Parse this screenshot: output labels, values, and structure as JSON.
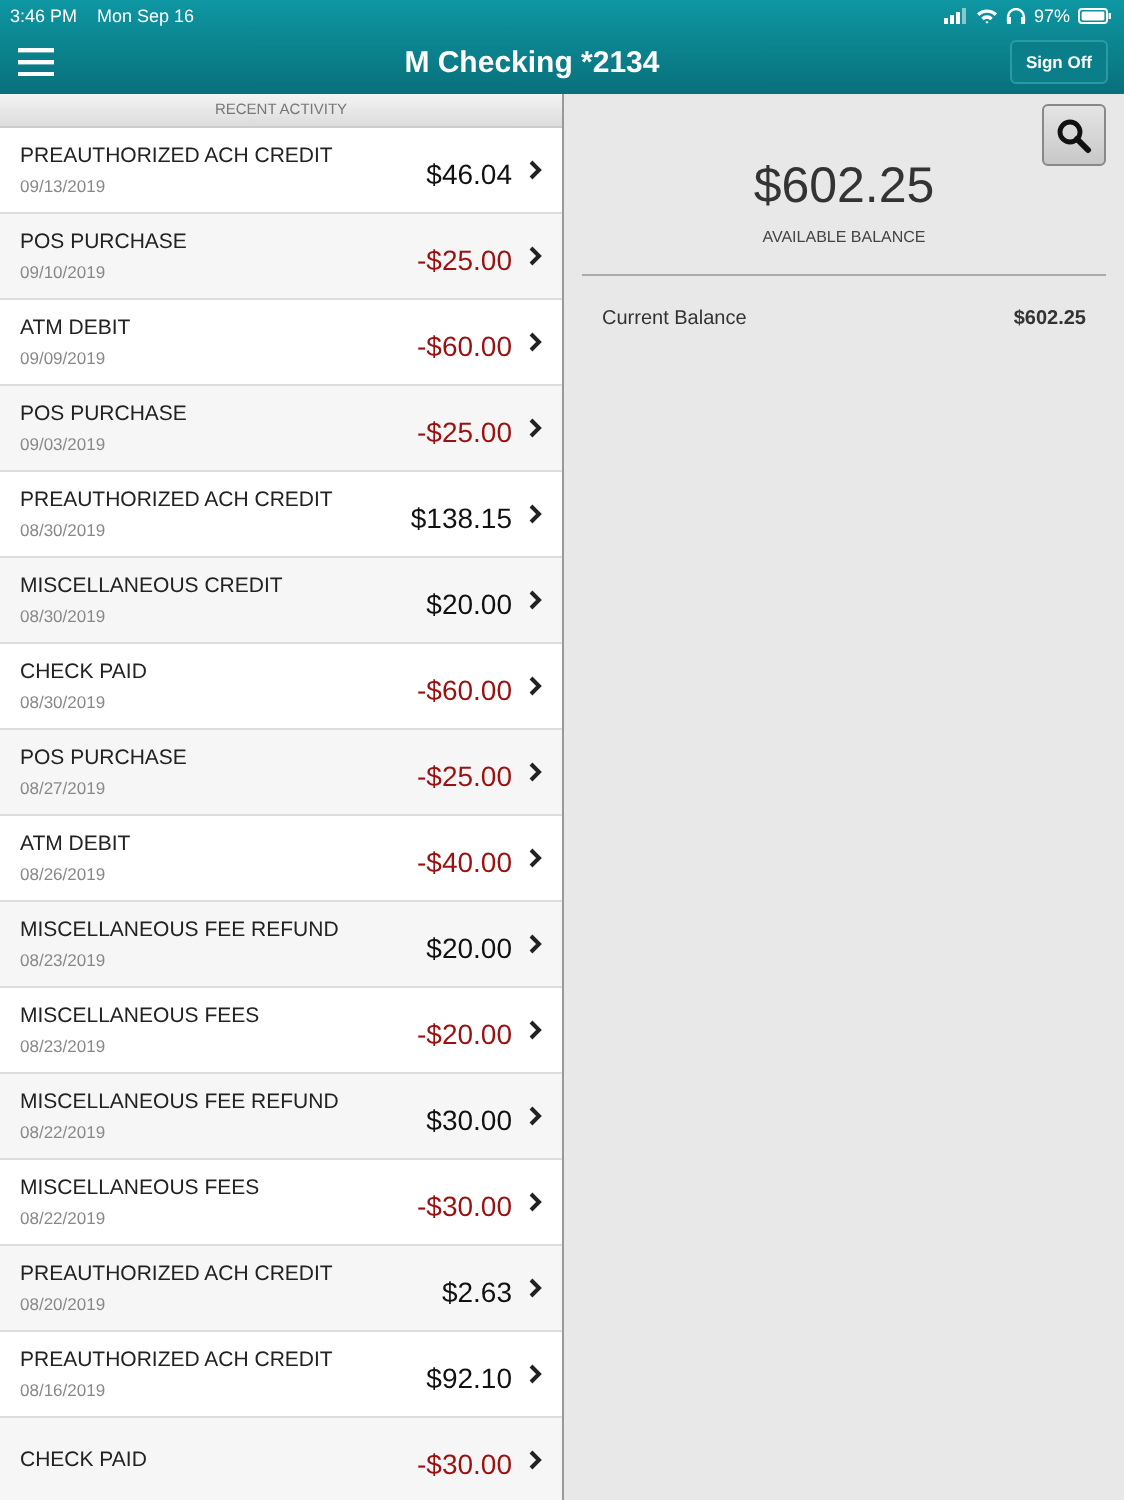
{
  "status_bar": {
    "time": "3:46 PM",
    "date": "Mon Sep 16",
    "battery": "97%"
  },
  "header": {
    "title": "M Checking *2134",
    "sign_off": "Sign Off"
  },
  "activity": {
    "heading": "RECENT ACTIVITY",
    "rows": [
      {
        "title": "PREAUTHORIZED ACH CREDIT",
        "date": "09/13/2019",
        "amount": "$46.04",
        "kind": "credit"
      },
      {
        "title": "POS PURCHASE",
        "date": "09/10/2019",
        "amount": "-$25.00",
        "kind": "debit"
      },
      {
        "title": "ATM DEBIT",
        "date": "09/09/2019",
        "amount": "-$60.00",
        "kind": "debit"
      },
      {
        "title": "POS PURCHASE",
        "date": "09/03/2019",
        "amount": "-$25.00",
        "kind": "debit"
      },
      {
        "title": "PREAUTHORIZED ACH CREDIT",
        "date": "08/30/2019",
        "amount": "$138.15",
        "kind": "credit"
      },
      {
        "title": "MISCELLANEOUS CREDIT",
        "date": "08/30/2019",
        "amount": "$20.00",
        "kind": "credit"
      },
      {
        "title": "CHECK PAID",
        "date": "08/30/2019",
        "amount": "-$60.00",
        "kind": "debit"
      },
      {
        "title": "POS PURCHASE",
        "date": "08/27/2019",
        "amount": "-$25.00",
        "kind": "debit"
      },
      {
        "title": "ATM DEBIT",
        "date": "08/26/2019",
        "amount": "-$40.00",
        "kind": "debit"
      },
      {
        "title": "MISCELLANEOUS FEE REFUND",
        "date": "08/23/2019",
        "amount": "$20.00",
        "kind": "credit"
      },
      {
        "title": "MISCELLANEOUS FEES",
        "date": "08/23/2019",
        "amount": "-$20.00",
        "kind": "debit"
      },
      {
        "title": "MISCELLANEOUS FEE REFUND",
        "date": "08/22/2019",
        "amount": "$30.00",
        "kind": "credit"
      },
      {
        "title": "MISCELLANEOUS FEES",
        "date": "08/22/2019",
        "amount": "-$30.00",
        "kind": "debit"
      },
      {
        "title": "PREAUTHORIZED ACH CREDIT",
        "date": "08/20/2019",
        "amount": "$2.63",
        "kind": "credit"
      },
      {
        "title": "PREAUTHORIZED ACH CREDIT",
        "date": "08/16/2019",
        "amount": "$92.10",
        "kind": "credit"
      },
      {
        "title": "CHECK PAID",
        "amount": "-$30.00",
        "kind": "debit"
      }
    ]
  },
  "balance": {
    "available": "$602.25",
    "available_label": "AVAILABLE BALANCE",
    "current_label": "Current Balance",
    "current": "$602.25"
  }
}
